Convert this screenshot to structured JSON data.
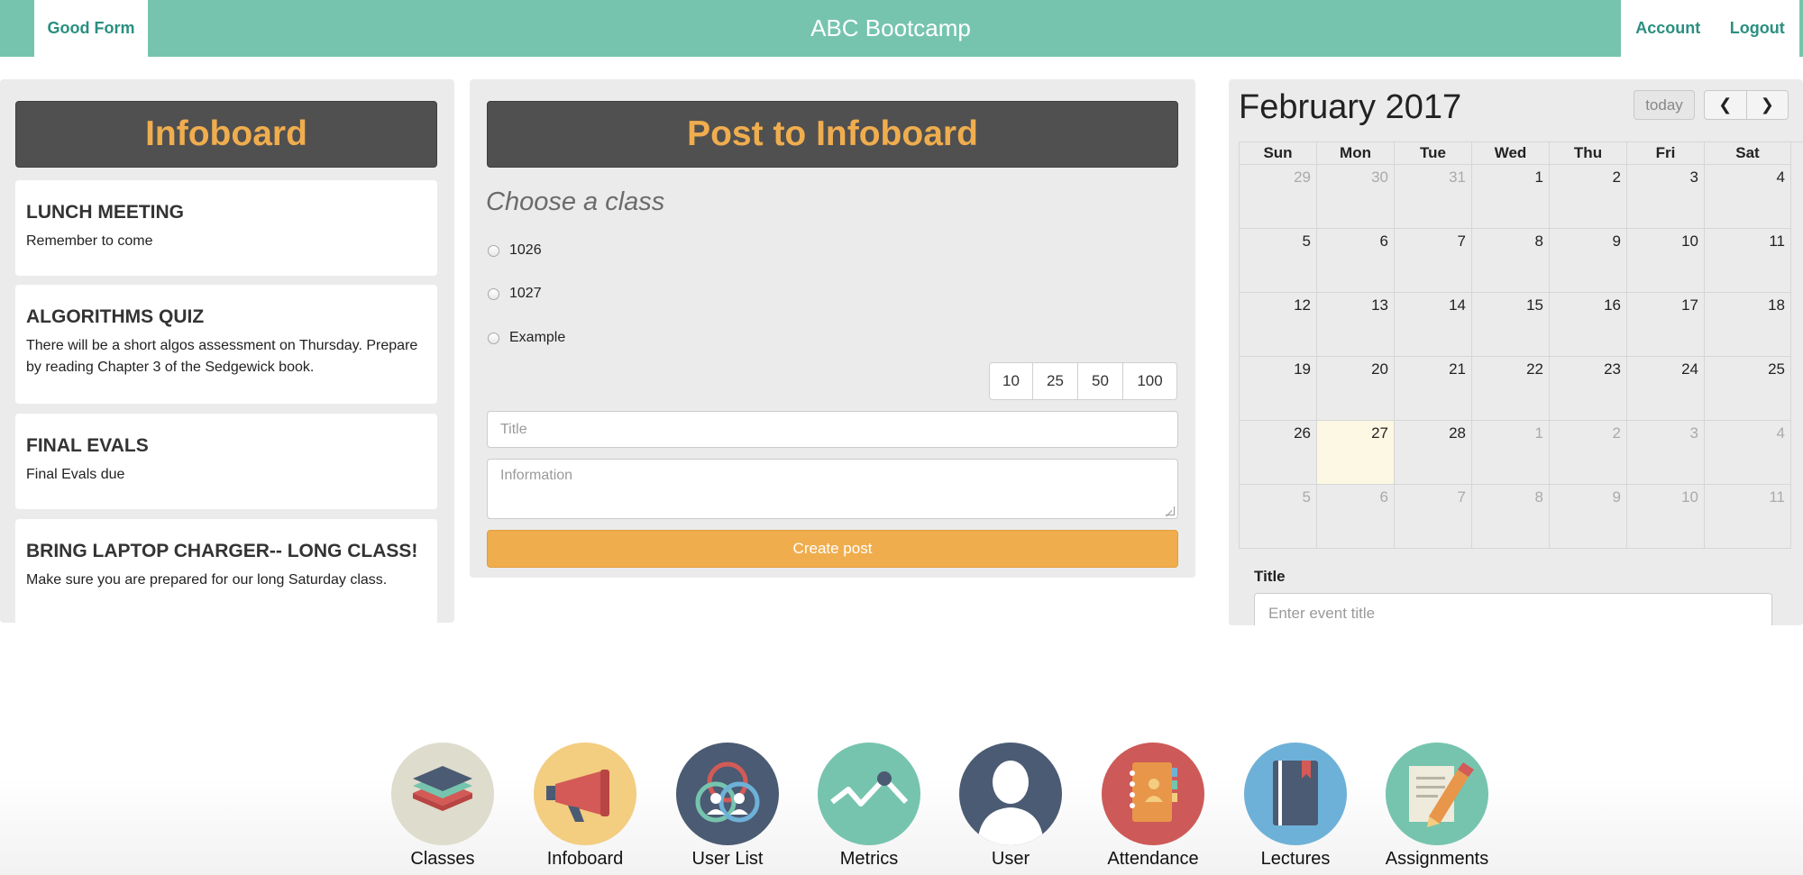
{
  "navbar": {
    "brand": "Good Form",
    "title": "ABC Bootcamp",
    "account": "Account",
    "logout": "Logout"
  },
  "infoboard": {
    "header": "Infoboard",
    "posts": [
      {
        "title": "LUNCH MEETING",
        "body": "Remember to come"
      },
      {
        "title": "ALGORITHMS QUIZ",
        "body": "There will be a short algos assessment on Thursday. Prepare by reading Chapter 3 of the Sedgewick book."
      },
      {
        "title": "FINAL EVALS",
        "body": "Final Evals due"
      },
      {
        "title": "BRING LAPTOP CHARGER-- LONG CLASS!",
        "body": "Make sure you are prepared for our long Saturday class."
      }
    ]
  },
  "post_form": {
    "header": "Post to Infoboard",
    "choose_label": "Choose a class",
    "classes": [
      "1026",
      "1027",
      "Example"
    ],
    "page_sizes": [
      "10",
      "25",
      "50",
      "100"
    ],
    "title_placeholder": "Title",
    "info_placeholder": "Information",
    "submit_label": "Create post"
  },
  "calendar": {
    "month_title": "February 2017",
    "today_label": "today",
    "prev_icon": "chevron-left-icon",
    "next_icon": "chevron-right-icon",
    "weekdays": [
      "Sun",
      "Mon",
      "Tue",
      "Wed",
      "Thu",
      "Fri",
      "Sat"
    ],
    "weeks": [
      [
        {
          "d": "29",
          "o": true
        },
        {
          "d": "30",
          "o": true
        },
        {
          "d": "31",
          "o": true
        },
        {
          "d": "1"
        },
        {
          "d": "2"
        },
        {
          "d": "3"
        },
        {
          "d": "4"
        }
      ],
      [
        {
          "d": "5"
        },
        {
          "d": "6"
        },
        {
          "d": "7"
        },
        {
          "d": "8"
        },
        {
          "d": "9"
        },
        {
          "d": "10"
        },
        {
          "d": "11"
        }
      ],
      [
        {
          "d": "12"
        },
        {
          "d": "13"
        },
        {
          "d": "14"
        },
        {
          "d": "15"
        },
        {
          "d": "16"
        },
        {
          "d": "17"
        },
        {
          "d": "18"
        }
      ],
      [
        {
          "d": "19"
        },
        {
          "d": "20"
        },
        {
          "d": "21"
        },
        {
          "d": "22"
        },
        {
          "d": "23"
        },
        {
          "d": "24"
        },
        {
          "d": "25"
        }
      ],
      [
        {
          "d": "26"
        },
        {
          "d": "27",
          "t": true
        },
        {
          "d": "28"
        },
        {
          "d": "1",
          "o": true
        },
        {
          "d": "2",
          "o": true
        },
        {
          "d": "3",
          "o": true
        },
        {
          "d": "4",
          "o": true
        }
      ],
      [
        {
          "d": "5",
          "o": true
        },
        {
          "d": "6",
          "o": true
        },
        {
          "d": "7",
          "o": true
        },
        {
          "d": "8",
          "o": true
        },
        {
          "d": "9",
          "o": true
        },
        {
          "d": "10",
          "o": true
        },
        {
          "d": "11",
          "o": true
        }
      ]
    ],
    "event_title_label": "Title",
    "event_title_placeholder": "Enter event title"
  },
  "dock": [
    {
      "label": "Classes",
      "icon": "layers-icon",
      "color": "#dedccc"
    },
    {
      "label": "Infoboard",
      "icon": "megaphone-icon",
      "color": "#f3cd80"
    },
    {
      "label": "User List",
      "icon": "user-group-icon",
      "color": "#4b5b73"
    },
    {
      "label": "Metrics",
      "icon": "line-chart-icon",
      "color": "#76c4ae"
    },
    {
      "label": "User",
      "icon": "user-silhouette-icon",
      "color": "#4b5b73"
    },
    {
      "label": "Attendance",
      "icon": "address-book-icon",
      "color": "#cd5a58"
    },
    {
      "label": "Lectures",
      "icon": "notebook-icon",
      "color": "#6eb1d8"
    },
    {
      "label": "Assignments",
      "icon": "pencil-paper-icon",
      "color": "#76c4ae"
    }
  ]
}
